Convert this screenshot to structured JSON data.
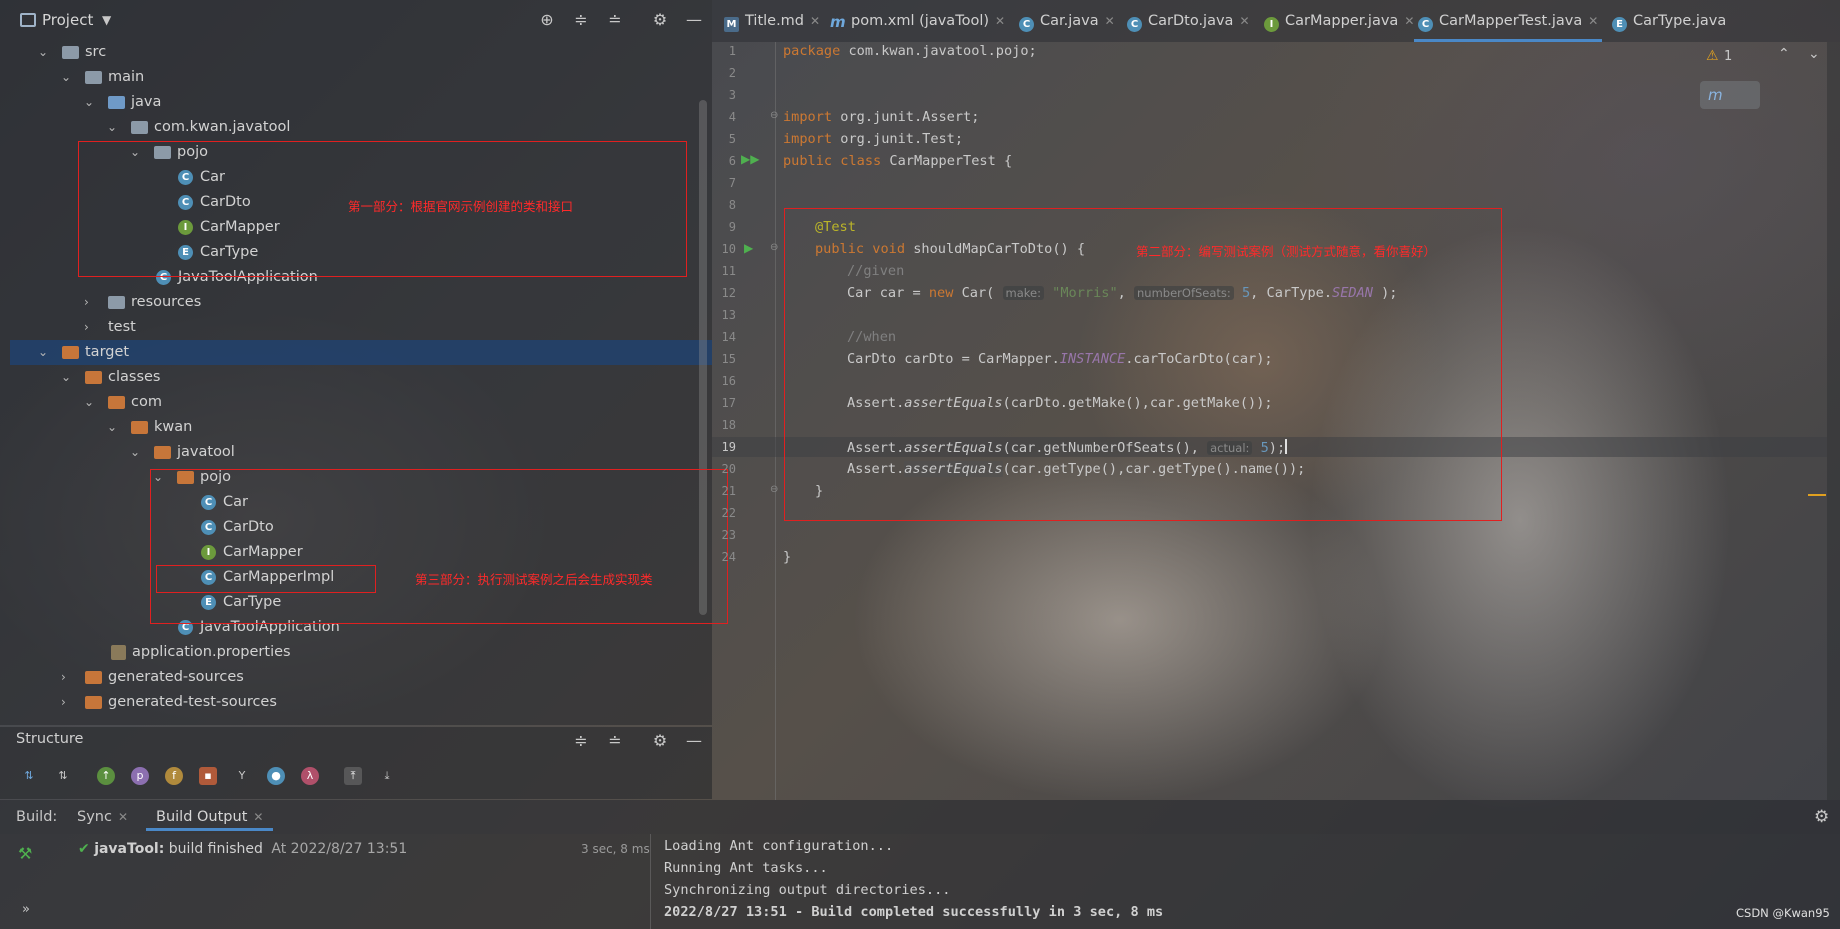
{
  "project": {
    "title": "Project",
    "tree": [
      {
        "label": "src"
      },
      {
        "label": "main"
      },
      {
        "label": "java"
      },
      {
        "label": "com.kwan.javatool"
      },
      {
        "label": "pojo"
      },
      {
        "label": "Car"
      },
      {
        "label": "CarDto"
      },
      {
        "label": "CarMapper"
      },
      {
        "label": "CarType"
      },
      {
        "label": "JavaToolApplication"
      },
      {
        "label": "resources"
      },
      {
        "label": "test"
      },
      {
        "label": "target"
      },
      {
        "label": "classes"
      },
      {
        "label": "com"
      },
      {
        "label": "kwan"
      },
      {
        "label": "javatool"
      },
      {
        "label": "pojo"
      },
      {
        "label": "Car"
      },
      {
        "label": "CarDto"
      },
      {
        "label": "CarMapper"
      },
      {
        "label": "CarMapperImpl"
      },
      {
        "label": "CarType"
      },
      {
        "label": "JavaToolApplication"
      },
      {
        "label": "application.properties"
      },
      {
        "label": "generated-sources"
      },
      {
        "label": "generated-test-sources"
      }
    ]
  },
  "annotations": {
    "part1": "第一部分：根据官网示例创建的类和接口",
    "part2": "第二部分：编写测试案例（测试方式随意，看你喜好）",
    "part3": "第三部分：执行测试案例之后会生成实现类"
  },
  "structure": {
    "title": "Structure"
  },
  "tabs": [
    {
      "label": "Title.md"
    },
    {
      "label": "pom.xml (javaTool)"
    },
    {
      "label": "Car.java"
    },
    {
      "label": "CarDto.java"
    },
    {
      "label": "CarMapper.java"
    },
    {
      "label": "CarMapperTest.java"
    },
    {
      "label": "CarType.java"
    }
  ],
  "editor": {
    "warnings": "1",
    "line_numbers": [
      "1",
      "2",
      "3",
      "4",
      "5",
      "6",
      "7",
      "8",
      "9",
      "10",
      "11",
      "12",
      "13",
      "14",
      "15",
      "16",
      "17",
      "18",
      "19",
      "20",
      "21",
      "22",
      "23",
      "24"
    ],
    "code": {
      "l1_kw": "package",
      "l1_rest": " com.kwan.javatool.pojo;",
      "l4_kw": "import",
      "l4_rest": " org.junit.Assert;",
      "l5_kw": "import",
      "l5_rest": " org.junit.Test;",
      "l6_kw": "public class",
      "l6_rest": " CarMapperTest {",
      "l9": "@Test",
      "l10_kw": "public void",
      "l10_rest": " shouldMapCarToDto() {",
      "l11": "//given",
      "l12_a": "Car car = ",
      "l12_new": "new",
      "l12_b": " Car(",
      "l12_hint1": "make:",
      "l12_str": "\"Morris\"",
      "l12_c": ",",
      "l12_hint2": "numberOfSeats:",
      "l12_num": "5",
      "l12_d": ", CarType.",
      "l12_static": "SEDAN",
      "l12_e": " );",
      "l14": "//when",
      "l15_a": "CarDto carDto = CarMapper.",
      "l15_static": "INSTANCE",
      "l15_b": ".carToCarDto(car);",
      "l17_a": "Assert.",
      "l17_m": "assertEquals",
      "l17_b": "(carDto.getMake(),car.getMake());",
      "l19_a": "Assert.",
      "l19_m": "assertEquals",
      "l19_b": "(car.getNumberOfSeats(),",
      "l19_hint": "actual:",
      "l19_num": "5",
      "l19_c": ");",
      "l20_a": "Assert.",
      "l20_m": "assertEquals",
      "l20_b": "(car.getType(),car.getType().name());",
      "l21": "}",
      "l24": "}"
    }
  },
  "bottom": {
    "build_label": "Build:",
    "tab_sync": "Sync",
    "tab_output": "Build Output",
    "status_name": "javaTool:",
    "status_text": " build finished",
    "status_time": "At 2022/8/27 13:51",
    "duration": "3 sec, 8 ms",
    "output": [
      "Loading Ant configuration...",
      "Running Ant tasks...",
      "Synchronizing output directories...",
      "2022/8/27 13:51 - Build completed successfully in 3 sec, 8 ms"
    ],
    "watermark": "CSDN @Kwan95"
  },
  "colors": {
    "accent": "#4a88c7",
    "annotation_red": "#e02020",
    "keyword": "#cc7832"
  }
}
